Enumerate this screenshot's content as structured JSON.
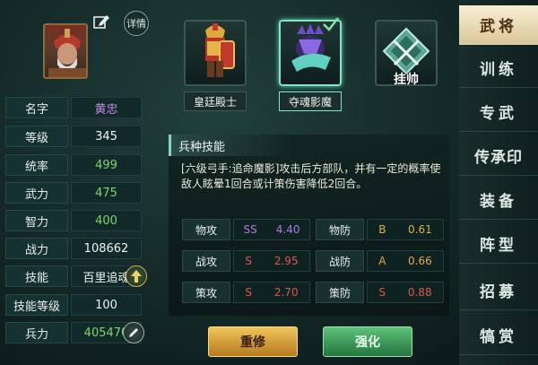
{
  "hero": {
    "detail_label": "详情",
    "stats": [
      {
        "label": "名字",
        "value": "黄忠",
        "color": "purple"
      },
      {
        "label": "等级",
        "value": "345",
        "color": "white"
      },
      {
        "label": "统率",
        "value": "499",
        "color": "green"
      },
      {
        "label": "武力",
        "value": "475",
        "color": "green"
      },
      {
        "label": "智力",
        "value": "400",
        "color": "green"
      },
      {
        "label": "战力",
        "value": "108662",
        "color": "white"
      },
      {
        "label": "技能",
        "value": "百里追魂",
        "color": "white"
      },
      {
        "label": "技能等级",
        "value": "100",
        "color": "white"
      },
      {
        "label": "兵力",
        "value": "405470",
        "color": "green"
      }
    ]
  },
  "units": [
    {
      "label": "皇廷殿士",
      "icon": "knight-icon"
    },
    {
      "label": "夺魂影魔",
      "icon": "shadow-demon-icon",
      "selected": true
    },
    {
      "label": "挂帅",
      "icon": "crossed-swords-icon"
    }
  ],
  "skill": {
    "title": "兵种技能",
    "description": "[六级弓手:追命魔影]攻击后方部队，并有一定的概率使敌人眩晕1回合或计策伤害降低2回合。",
    "attributes": [
      {
        "label": "物攻",
        "grade": "SS",
        "value": "4.40"
      },
      {
        "label": "物防",
        "grade": "B",
        "value": "0.61"
      },
      {
        "label": "战攻",
        "grade": "S",
        "value": "2.95"
      },
      {
        "label": "战防",
        "grade": "A",
        "value": "0.66"
      },
      {
        "label": "策攻",
        "grade": "S",
        "value": "2.70"
      },
      {
        "label": "策防",
        "grade": "S",
        "value": "0.88"
      }
    ]
  },
  "buttons": {
    "rebuild": "重修",
    "strengthen": "强化"
  },
  "tabs": [
    "武将",
    "训练",
    "专武",
    "传承印",
    "装备",
    "阵型",
    "招募",
    "犒赏"
  ],
  "colors": {
    "accent": "#7fe6c7",
    "gold": "#e8b84a",
    "active_tab": "#f3e8c8"
  }
}
